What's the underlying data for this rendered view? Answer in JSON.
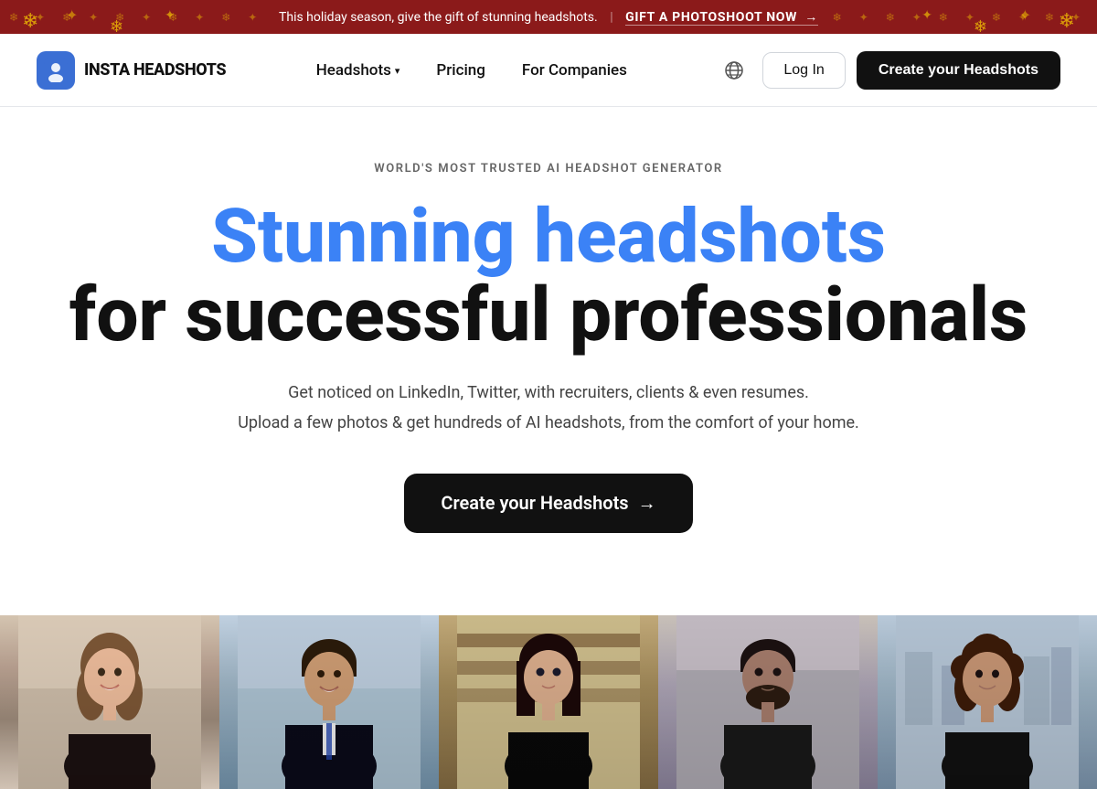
{
  "banner": {
    "text": "This holiday season, give the gift of stunning headshots.",
    "separator": "|",
    "link_text": "GIFT A PHOTOSHOOT NOW",
    "link_arrow": "→"
  },
  "navbar": {
    "logo_text": "INSTA HEADSHOTS",
    "nav_items": [
      {
        "id": "headshots",
        "label": "Headshots",
        "has_dropdown": true
      },
      {
        "id": "pricing",
        "label": "Pricing",
        "has_dropdown": false
      },
      {
        "id": "for-companies",
        "label": "For Companies",
        "has_dropdown": false
      }
    ],
    "login_label": "Log In",
    "cta_label": "Create your Headshots"
  },
  "hero": {
    "subtitle": "WORLD'S MOST TRUSTED AI HEADSHOT GENERATOR",
    "title_line1": "Stunning headshots",
    "title_line2": "for successful professionals",
    "description_line1": "Get noticed on LinkedIn, Twitter, with recruiters, clients & even resumes.",
    "description_line2": "Upload a few photos & get hundreds of AI headshots, from the comfort of your home.",
    "cta_label": "Create your Headshots",
    "cta_arrow": "→"
  },
  "photos": [
    {
      "id": 1,
      "alt": "Professional woman smiling"
    },
    {
      "id": 2,
      "alt": "Professional man in suit"
    },
    {
      "id": 3,
      "alt": "Professional woman with dark hair"
    },
    {
      "id": 4,
      "alt": "Professional man with beard"
    },
    {
      "id": 5,
      "alt": "Professional woman with curly hair"
    }
  ],
  "colors": {
    "accent_blue": "#3b82f6",
    "dark": "#111111",
    "banner_bg": "#8b1a1a",
    "banner_gold": "#ffd700"
  },
  "icons": {
    "globe": "🌐",
    "snowflake": "❄",
    "star": "✦",
    "chevron_down": "▾",
    "arrow_right": "→",
    "logo_emoji": "👤"
  }
}
